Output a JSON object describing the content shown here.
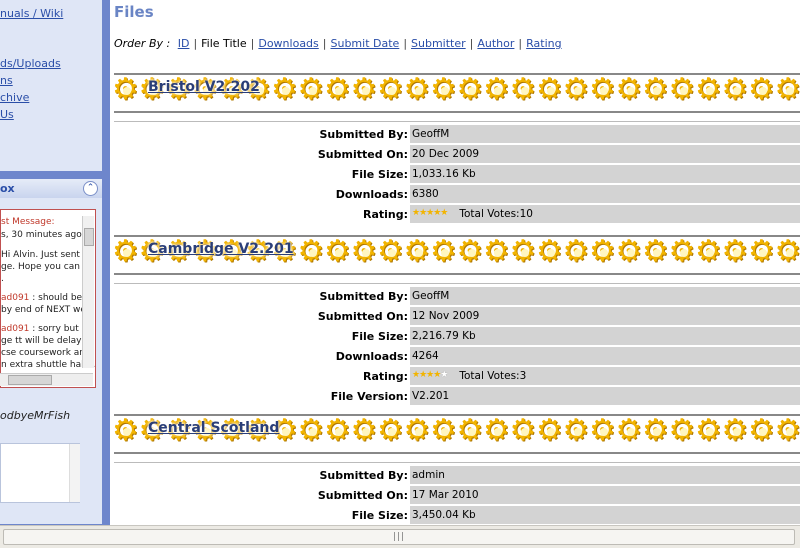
{
  "sidebar": {
    "menu": [
      {
        "label": "nuals / Wiki"
      },
      {
        "label": "ds/Uploads"
      },
      {
        "label": "ns"
      },
      {
        "label": "chive"
      },
      {
        "label": "Us"
      }
    ],
    "shoutbox": {
      "title": "ox",
      "collapse_icon": "chevron-up-icon",
      "lines": [
        {
          "text": "st Message:"
        },
        {
          "text": "s, 30 minutes ago"
        },
        {
          "text": "Hi Alvin. Just sent yo"
        },
        {
          "text": "ge. Hope you can"
        },
        {
          "text": "."
        },
        {
          "user": "ad091",
          "text": " : should be"
        },
        {
          "text": "by end of NEXT we"
        },
        {
          "user": "ad091",
          "text": " : sorry but m"
        },
        {
          "text": "ge tt will be delayed"
        },
        {
          "text": "cse coursework and"
        },
        {
          "text": "n extra shuttle haha."
        }
      ],
      "user_display": "odbyeMrFish"
    }
  },
  "main": {
    "title": "Files",
    "order_by": {
      "label": "Order By :",
      "options": [
        {
          "label": "ID",
          "link": true
        },
        {
          "label": "File Title",
          "link": false
        },
        {
          "label": "Downloads",
          "link": true
        },
        {
          "label": "Submit Date",
          "link": true
        },
        {
          "label": "Submitter",
          "link": true
        },
        {
          "label": "Author",
          "link": true
        },
        {
          "label": "Rating",
          "link": true
        }
      ]
    },
    "files": [
      {
        "title": "Bristol V2.202",
        "rows": [
          {
            "label": "Submitted By:",
            "value": "GeoffM"
          },
          {
            "label": "Submitted On:",
            "value": "20 Dec 2009"
          },
          {
            "label": "File Size:",
            "value": "1,033.16 Kb"
          },
          {
            "label": "Downloads:",
            "value": "6380"
          },
          {
            "label": "Rating:",
            "rating": 5,
            "votes": "Total Votes:10"
          }
        ]
      },
      {
        "title": "Cambridge V2.201",
        "rows": [
          {
            "label": "Submitted By:",
            "value": "GeoffM"
          },
          {
            "label": "Submitted On:",
            "value": "12 Nov 2009"
          },
          {
            "label": "File Size:",
            "value": "2,216.79 Kb"
          },
          {
            "label": "Downloads:",
            "value": "4264"
          },
          {
            "label": "Rating:",
            "rating": 4,
            "votes": "Total Votes:3"
          },
          {
            "label": "File Version:",
            "value": "V2.201"
          }
        ]
      },
      {
        "title": "Central Scotland",
        "rows": [
          {
            "label": "Submitted By:",
            "value": "admin"
          },
          {
            "label": "Submitted On:",
            "value": "17 Mar 2010"
          },
          {
            "label": "File Size:",
            "value": "3,450.04 Kb"
          }
        ]
      }
    ]
  },
  "scrollbar": {
    "grip": "|||"
  }
}
